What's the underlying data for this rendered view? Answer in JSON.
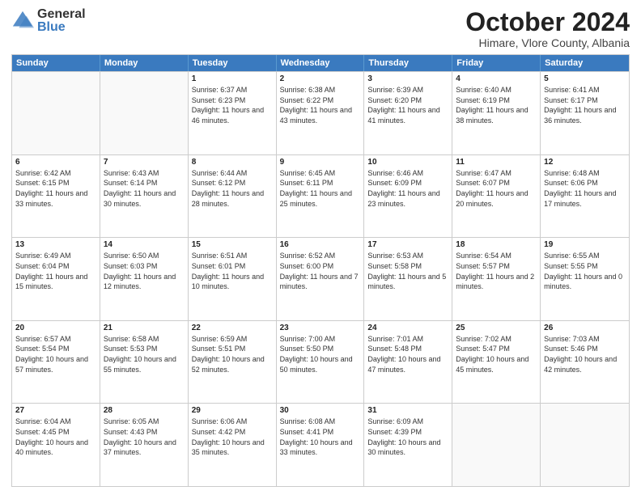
{
  "logo": {
    "general": "General",
    "blue": "Blue"
  },
  "header": {
    "month": "October 2024",
    "location": "Himare, Vlore County, Albania"
  },
  "weekdays": [
    "Sunday",
    "Monday",
    "Tuesday",
    "Wednesday",
    "Thursday",
    "Friday",
    "Saturday"
  ],
  "rows": [
    [
      {
        "day": "",
        "sunrise": "",
        "sunset": "",
        "daylight": "",
        "empty": true
      },
      {
        "day": "",
        "sunrise": "",
        "sunset": "",
        "daylight": "",
        "empty": true
      },
      {
        "day": "1",
        "sunrise": "Sunrise: 6:37 AM",
        "sunset": "Sunset: 6:23 PM",
        "daylight": "Daylight: 11 hours and 46 minutes."
      },
      {
        "day": "2",
        "sunrise": "Sunrise: 6:38 AM",
        "sunset": "Sunset: 6:22 PM",
        "daylight": "Daylight: 11 hours and 43 minutes."
      },
      {
        "day": "3",
        "sunrise": "Sunrise: 6:39 AM",
        "sunset": "Sunset: 6:20 PM",
        "daylight": "Daylight: 11 hours and 41 minutes."
      },
      {
        "day": "4",
        "sunrise": "Sunrise: 6:40 AM",
        "sunset": "Sunset: 6:19 PM",
        "daylight": "Daylight: 11 hours and 38 minutes."
      },
      {
        "day": "5",
        "sunrise": "Sunrise: 6:41 AM",
        "sunset": "Sunset: 6:17 PM",
        "daylight": "Daylight: 11 hours and 36 minutes."
      }
    ],
    [
      {
        "day": "6",
        "sunrise": "Sunrise: 6:42 AM",
        "sunset": "Sunset: 6:15 PM",
        "daylight": "Daylight: 11 hours and 33 minutes."
      },
      {
        "day": "7",
        "sunrise": "Sunrise: 6:43 AM",
        "sunset": "Sunset: 6:14 PM",
        "daylight": "Daylight: 11 hours and 30 minutes."
      },
      {
        "day": "8",
        "sunrise": "Sunrise: 6:44 AM",
        "sunset": "Sunset: 6:12 PM",
        "daylight": "Daylight: 11 hours and 28 minutes."
      },
      {
        "day": "9",
        "sunrise": "Sunrise: 6:45 AM",
        "sunset": "Sunset: 6:11 PM",
        "daylight": "Daylight: 11 hours and 25 minutes."
      },
      {
        "day": "10",
        "sunrise": "Sunrise: 6:46 AM",
        "sunset": "Sunset: 6:09 PM",
        "daylight": "Daylight: 11 hours and 23 minutes."
      },
      {
        "day": "11",
        "sunrise": "Sunrise: 6:47 AM",
        "sunset": "Sunset: 6:07 PM",
        "daylight": "Daylight: 11 hours and 20 minutes."
      },
      {
        "day": "12",
        "sunrise": "Sunrise: 6:48 AM",
        "sunset": "Sunset: 6:06 PM",
        "daylight": "Daylight: 11 hours and 17 minutes."
      }
    ],
    [
      {
        "day": "13",
        "sunrise": "Sunrise: 6:49 AM",
        "sunset": "Sunset: 6:04 PM",
        "daylight": "Daylight: 11 hours and 15 minutes."
      },
      {
        "day": "14",
        "sunrise": "Sunrise: 6:50 AM",
        "sunset": "Sunset: 6:03 PM",
        "daylight": "Daylight: 11 hours and 12 minutes."
      },
      {
        "day": "15",
        "sunrise": "Sunrise: 6:51 AM",
        "sunset": "Sunset: 6:01 PM",
        "daylight": "Daylight: 11 hours and 10 minutes."
      },
      {
        "day": "16",
        "sunrise": "Sunrise: 6:52 AM",
        "sunset": "Sunset: 6:00 PM",
        "daylight": "Daylight: 11 hours and 7 minutes."
      },
      {
        "day": "17",
        "sunrise": "Sunrise: 6:53 AM",
        "sunset": "Sunset: 5:58 PM",
        "daylight": "Daylight: 11 hours and 5 minutes."
      },
      {
        "day": "18",
        "sunrise": "Sunrise: 6:54 AM",
        "sunset": "Sunset: 5:57 PM",
        "daylight": "Daylight: 11 hours and 2 minutes."
      },
      {
        "day": "19",
        "sunrise": "Sunrise: 6:55 AM",
        "sunset": "Sunset: 5:55 PM",
        "daylight": "Daylight: 11 hours and 0 minutes."
      }
    ],
    [
      {
        "day": "20",
        "sunrise": "Sunrise: 6:57 AM",
        "sunset": "Sunset: 5:54 PM",
        "daylight": "Daylight: 10 hours and 57 minutes."
      },
      {
        "day": "21",
        "sunrise": "Sunrise: 6:58 AM",
        "sunset": "Sunset: 5:53 PM",
        "daylight": "Daylight: 10 hours and 55 minutes."
      },
      {
        "day": "22",
        "sunrise": "Sunrise: 6:59 AM",
        "sunset": "Sunset: 5:51 PM",
        "daylight": "Daylight: 10 hours and 52 minutes."
      },
      {
        "day": "23",
        "sunrise": "Sunrise: 7:00 AM",
        "sunset": "Sunset: 5:50 PM",
        "daylight": "Daylight: 10 hours and 50 minutes."
      },
      {
        "day": "24",
        "sunrise": "Sunrise: 7:01 AM",
        "sunset": "Sunset: 5:48 PM",
        "daylight": "Daylight: 10 hours and 47 minutes."
      },
      {
        "day": "25",
        "sunrise": "Sunrise: 7:02 AM",
        "sunset": "Sunset: 5:47 PM",
        "daylight": "Daylight: 10 hours and 45 minutes."
      },
      {
        "day": "26",
        "sunrise": "Sunrise: 7:03 AM",
        "sunset": "Sunset: 5:46 PM",
        "daylight": "Daylight: 10 hours and 42 minutes."
      }
    ],
    [
      {
        "day": "27",
        "sunrise": "Sunrise: 6:04 AM",
        "sunset": "Sunset: 4:45 PM",
        "daylight": "Daylight: 10 hours and 40 minutes."
      },
      {
        "day": "28",
        "sunrise": "Sunrise: 6:05 AM",
        "sunset": "Sunset: 4:43 PM",
        "daylight": "Daylight: 10 hours and 37 minutes."
      },
      {
        "day": "29",
        "sunrise": "Sunrise: 6:06 AM",
        "sunset": "Sunset: 4:42 PM",
        "daylight": "Daylight: 10 hours and 35 minutes."
      },
      {
        "day": "30",
        "sunrise": "Sunrise: 6:08 AM",
        "sunset": "Sunset: 4:41 PM",
        "daylight": "Daylight: 10 hours and 33 minutes."
      },
      {
        "day": "31",
        "sunrise": "Sunrise: 6:09 AM",
        "sunset": "Sunset: 4:39 PM",
        "daylight": "Daylight: 10 hours and 30 minutes."
      },
      {
        "day": "",
        "sunrise": "",
        "sunset": "",
        "daylight": "",
        "empty": true
      },
      {
        "day": "",
        "sunrise": "",
        "sunset": "",
        "daylight": "",
        "empty": true
      }
    ]
  ]
}
